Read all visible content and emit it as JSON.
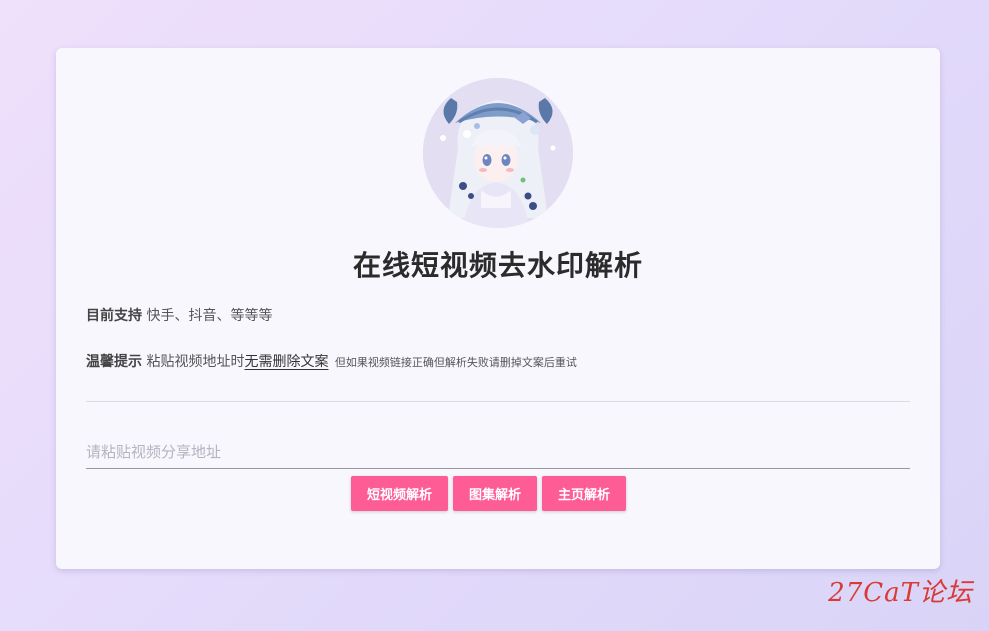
{
  "colors": {
    "accent": "#fd5c95",
    "watermark": "#d93a35"
  },
  "page": {
    "title": "在线短视频去水印解析"
  },
  "support": {
    "label": "目前支持",
    "text": "快手、抖音、等等等"
  },
  "tip": {
    "label": "温馨提示",
    "text_before": "粘贴视频地址时",
    "emphasis": "无需删除文案",
    "small": "但如果视频链接正确但解析失败请删掉文案后重试"
  },
  "input": {
    "placeholder": "请粘贴视频分享地址",
    "value": ""
  },
  "buttons": {
    "short_video": "短视频解析",
    "gallery": "图集解析",
    "homepage": "主页解析"
  },
  "avatar": {
    "icon": "anime-avatar-image"
  },
  "watermark": {
    "text": "27CaT论坛"
  }
}
